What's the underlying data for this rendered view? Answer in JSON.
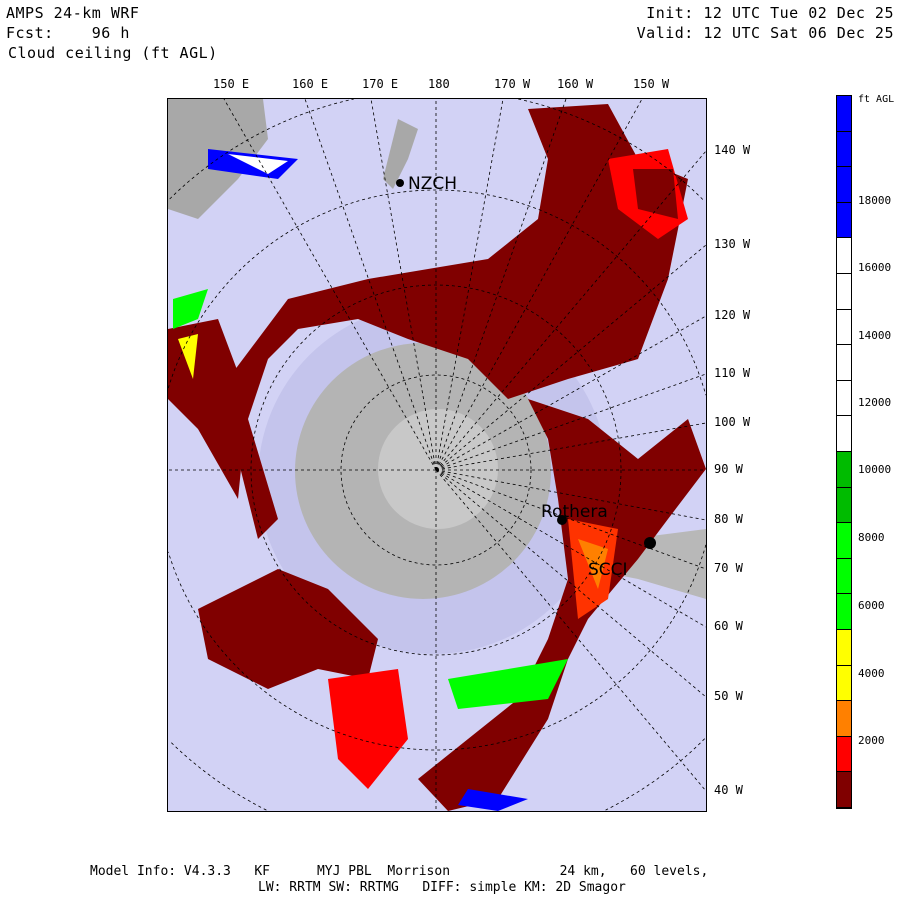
{
  "header": {
    "model": "AMPS 24-km WRF",
    "fcst_label": "Fcst:",
    "fcst_value": "96 h",
    "field": "Cloud ceiling (ft AGL)",
    "init": "Init: 12 UTC Tue 02 Dec 25",
    "valid": "Valid: 12 UTC Sat 06 Dec 25"
  },
  "top_axis": [
    "150 E",
    "160 E",
    "170 E",
    "180",
    "170 W",
    "160 W",
    "150 W"
  ],
  "right_axis": [
    "140 W",
    "130 W",
    "120 W",
    "110 W",
    "100 W",
    "90 W",
    "80 W",
    "70 W",
    "60 W",
    "50 W",
    "40 W"
  ],
  "stations": [
    "NZCH",
    "Rothera",
    "SCCI"
  ],
  "colorbar": {
    "units": "ft AGL",
    "labels": [
      "18000",
      "16000",
      "14000",
      "12000",
      "10000",
      "8000",
      "6000",
      "4000",
      "2000"
    ],
    "colors": [
      "#ffffff",
      "#0000ff",
      "#0000ff",
      "#0000ff",
      "#0000ff",
      "#ffffff",
      "#ffffff",
      "#ffffff",
      "#ffffff",
      "#ffffff",
      "#ffffff",
      "#00bb00",
      "#00bb00",
      "#00ff00",
      "#00ff00",
      "#00ff00",
      "#ffff00",
      "#ffff00",
      "#ff8000",
      "#ff0000",
      "#800000"
    ]
  },
  "footer": {
    "line1": "Model Info: V4.3.3   KF      MYJ PBL  Morrison              24 km,   60 levels,",
    "line2": "LW: RRTM SW: RRTMG   DIFF: simple KM: 2D Smagor"
  }
}
